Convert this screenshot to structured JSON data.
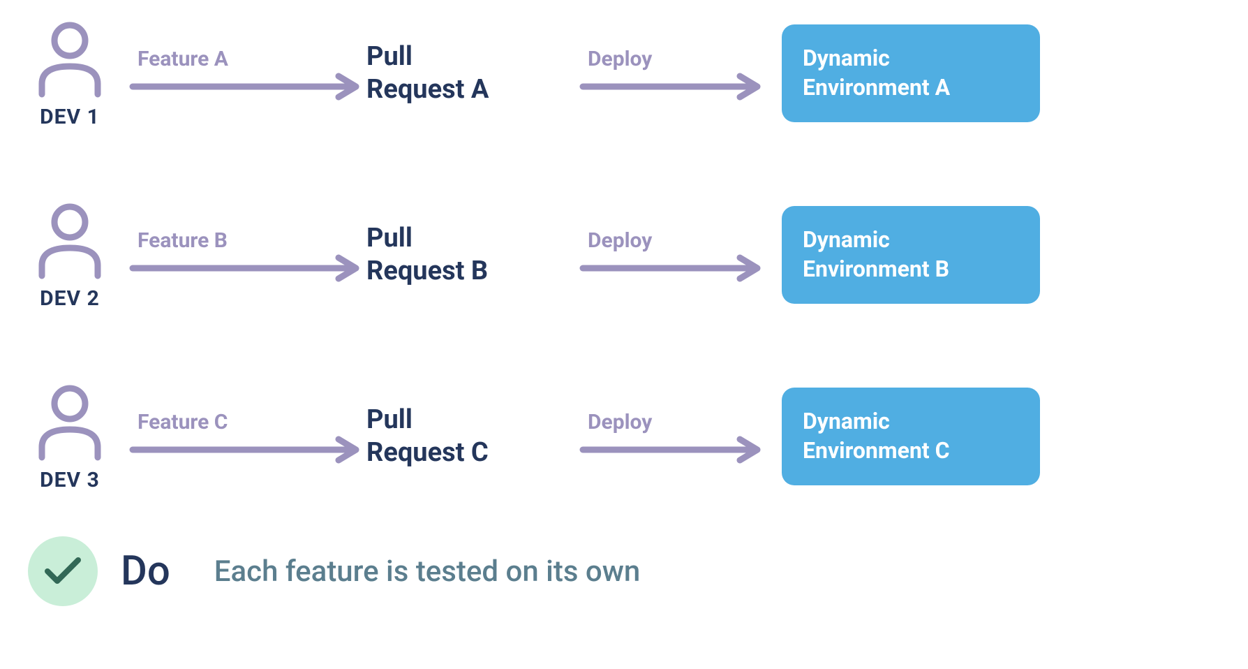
{
  "rows": [
    {
      "dev_label": "DEV 1",
      "feature_label": "Feature A",
      "pr_line1": "Pull",
      "pr_line2": "Request A",
      "deploy_label": "Deploy",
      "env_line1": "Dynamic",
      "env_line2": "Environment A"
    },
    {
      "dev_label": "DEV 2",
      "feature_label": "Feature B",
      "pr_line1": "Pull",
      "pr_line2": "Request B",
      "deploy_label": "Deploy",
      "env_line1": "Dynamic",
      "env_line2": "Environment B"
    },
    {
      "dev_label": "DEV 3",
      "feature_label": "Feature C",
      "pr_line1": "Pull",
      "pr_line2": "Request C",
      "deploy_label": "Deploy",
      "env_line1": "Dynamic",
      "env_line2": "Environment C"
    }
  ],
  "footer": {
    "do_label": "Do",
    "caption": "Each feature is tested on its own"
  },
  "colors": {
    "arrow": "#9b92bd",
    "dark_text": "#24365b",
    "env_bg": "#50aee2",
    "check_bg": "#c9eed8",
    "check_stroke": "#326856",
    "caption": "#5b7e8e"
  }
}
